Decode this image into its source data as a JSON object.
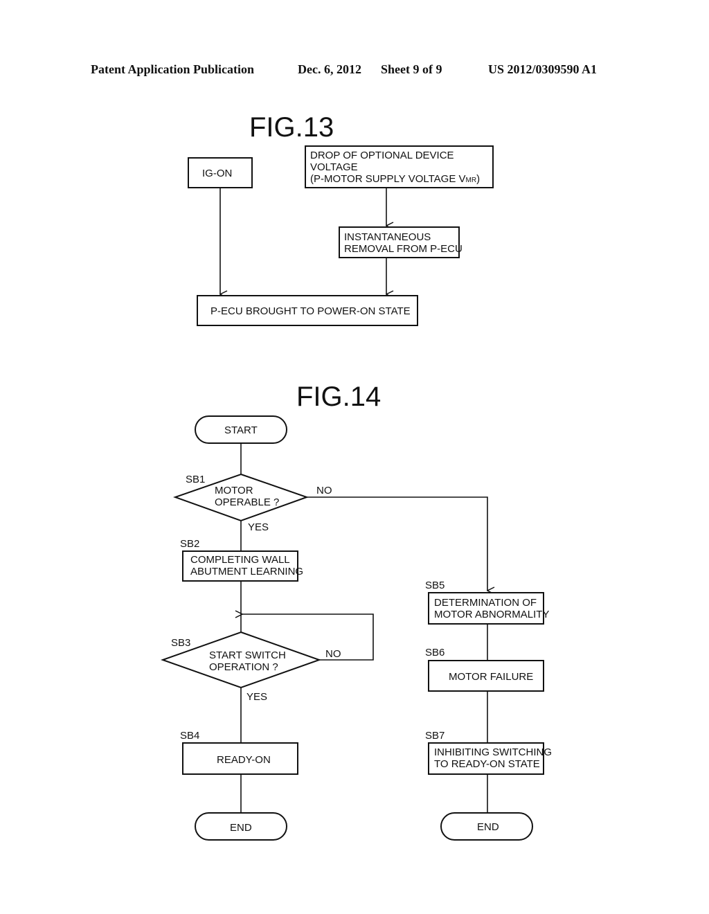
{
  "header": {
    "publication": "Patent Application Publication",
    "date": "Dec. 6, 2012",
    "sheet": "Sheet 9 of 9",
    "number": "US 2012/0309590 A1"
  },
  "fig13": {
    "title": "FIG.13",
    "ig_on": "IG-ON",
    "drop": [
      "DROP OF OPTIONAL DEVICE",
      "VOLTAGE",
      "(P-MOTOR SUPPLY VOLTAGE V"
    ],
    "drop_subscript": "MR",
    "drop_close": ")",
    "removal": [
      "INSTANTANEOUS",
      "REMOVAL FROM P-ECU"
    ],
    "power_on": "P-ECU BROUGHT TO POWER-ON STATE"
  },
  "fig14": {
    "title": "FIG.14",
    "start": "START",
    "sb1": {
      "id": "SB1",
      "text": [
        "MOTOR",
        "OPERABLE ?"
      ]
    },
    "sb2": {
      "id": "SB2",
      "text": [
        "COMPLETING WALL",
        "ABUTMENT LEARNING"
      ]
    },
    "sb3": {
      "id": "SB3",
      "text": [
        "START SWITCH",
        "OPERATION ?"
      ]
    },
    "sb4": {
      "id": "SB4",
      "text": "READY-ON"
    },
    "sb5": {
      "id": "SB5",
      "text": [
        "DETERMINATION OF",
        "MOTOR ABNORMALITY"
      ]
    },
    "sb6": {
      "id": "SB6",
      "text": "MOTOR FAILURE"
    },
    "sb7": {
      "id": "SB7",
      "text": [
        "INHIBITING SWITCHING",
        "TO READY-ON STATE"
      ]
    },
    "end": "END",
    "yes": "YES",
    "no": "NO"
  }
}
